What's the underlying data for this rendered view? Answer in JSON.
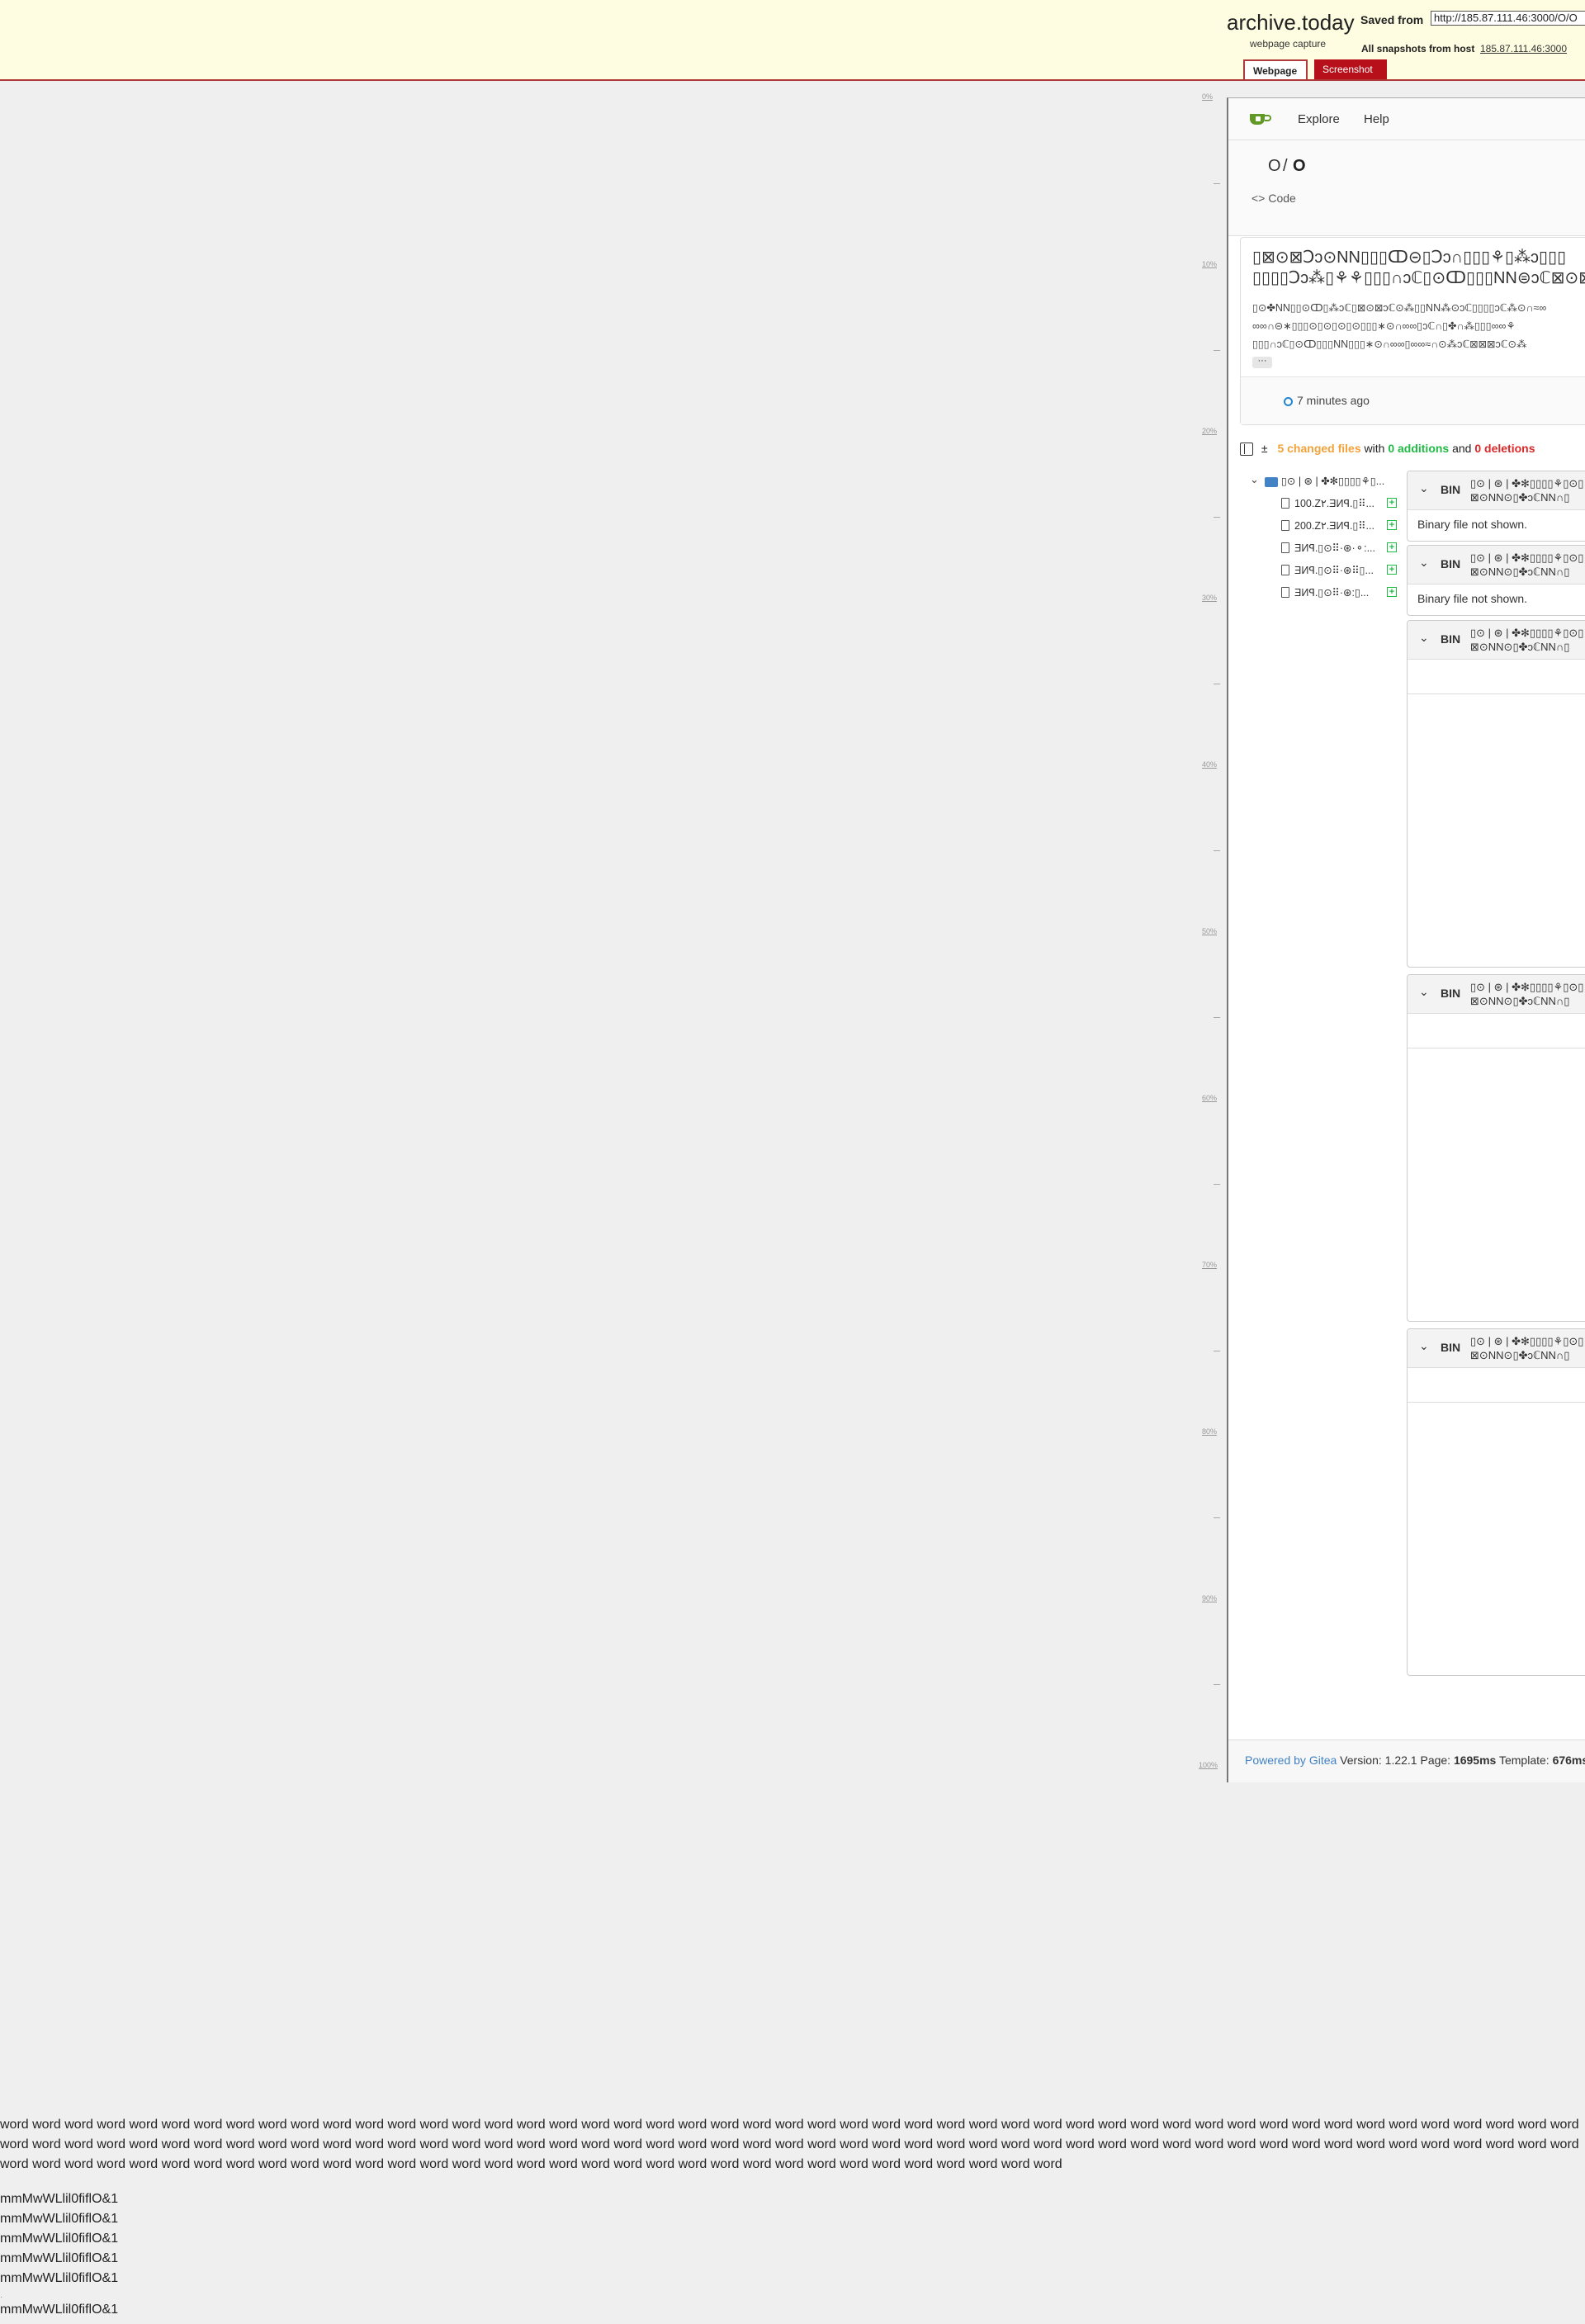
{
  "archive": {
    "brand": "archive.today",
    "brand_sub": "webpage capture",
    "saved_label": "Saved from",
    "saved_url": "http://185.87.111.46:3000/O/O",
    "snapshots_label": "All snapshots  from host",
    "snapshots_host": "185.87.111.46:3000",
    "tab_webpage": "Webpage",
    "tab_screenshot": "Screenshot",
    "scale": [
      "0%",
      "10%",
      "20%",
      "30%",
      "40%",
      "50%",
      "60%",
      "70%",
      "80%",
      "90%",
      "100%"
    ]
  },
  "gitea": {
    "nav_explore": "Explore",
    "nav_help": "Help",
    "repo_owner": "O",
    "repo_sep": "/",
    "repo_name": "O",
    "code_tab": "Code",
    "commit_title": "▯⊠⊙⊠Ↄↄ⊙NN▯▯▯ↀ⊝▯Ↄↄ∩▯▯▯⚘▯⁂ↄ▯▯▯ ▯▯▯▯Ↄↄ⁂▯⚘⚘▯▯▯∩ↄℂ▯⊙ↀ▯▯▯NN⊜ↄℂ⊠⊙⊠",
    "commit_body": "▯⊙✤NN▯▯⊙ↀ▯⁂ↄℂ▯⊠⊙⊠ↄℂ⊙⁂▯▯NN⁂⊙ↄℂ▯▯▯▯ↄℂ⁂⊙∩≈∞ ∞∞∩⊝∗▯▯▯⊙▯⊙▯⊙▯⊙▯▯▯∗⊙∩∞∞▯ↄℂ∩▯✤∩⁂▯▯▯∞∞⚘ ▯▯▯∩ↄℂ▯⊙ↀ▯▯▯NN▯▯▯∗⊙∩∞∞▯∞∞≈∩⊙⁂ↄℂ⊠⊠⊠ↄℂ⊙⁂",
    "ellipsis": "···",
    "commit_time": "7 minutes ago",
    "stats_changed": "5 changed files",
    "stats_with": " with ",
    "stats_additions": "0 additions",
    "stats_and": " and ",
    "stats_deletions": "0 deletions",
    "tree_folder": "▯⊙ | ⊛ | ✤✻▯▯▯▯⚘▯...",
    "tree_files": [
      "100.Z٢.ƎИꟼ.▯⠿...",
      "200.Z٢.ƎИꟼ.▯⠿...",
      "ƎИꟼ.▯⊙⠿·⊛·⚬:...",
      "ƎИꟼ.▯⊙⠿·⊛⠿▯...",
      "ƎИꟼ.▯⊙⠿·⊛:▯..."
    ],
    "diff_bin": "BIN",
    "diff_names": [
      [
        "▯⊙ | ⊛ | ✤✻▯▯▯▯⚘▯⊙▯",
        "⊠⊙NN⊙▯✤ↄℂNN∩▯"
      ],
      [
        "▯⊙ | ⊛ | ✤✻▯▯▯▯⚘▯⊙▯",
        "⊠⊙NN⊙▯✤ↄℂNN∩▯"
      ],
      [
        "▯⊙ | ⊛ | ✤✻▯▯▯▯⚘▯⊙▯",
        "⊠⊙NN⊙▯✤ↄℂNN∩▯"
      ],
      [
        "▯⊙ | ⊛ | ✤✻▯▯▯▯⚘▯⊙▯",
        "⊠⊙NN⊙▯✤ↄℂNN∩▯"
      ],
      [
        "▯⊙ | ⊛ | ✤✻▯▯▯▯⚘▯⊙▯",
        "⊠⊙NN⊙▯✤ↄℂNN∩▯"
      ]
    ],
    "binary_msg": "Binary file not shown.",
    "footer_link": "Powered by Gitea",
    "footer_version": " Version: 1.22.1 Page: ",
    "footer_page_ms": "1695ms",
    "footer_template": " Template: ",
    "footer_template_ms": "676ms"
  },
  "bottom": {
    "words": "word word word word word word word word word word word word word word word word word word word word word word word word word word word word word word word word word word word word word word word word word word word word word word word word word word word word word word word word word word word word word word word word word word word word word word word word word word word word word word word word word word word word word word word word word word word word word word word word word word word word word word word word word word word word word word word word word word word word word word word word word word word word word word word word word word word",
    "mlines": [
      "mmMwWLlil0fiflO&1",
      "mmMwWLlil0fiflO&1",
      "mmMwWLlil0fiflO&1",
      "mmMwWLlil0fiflO&1",
      "mmMwWLlil0fiflO&1",
      "mmMwWLlil0fiflO&1"
    ]
  }
}
